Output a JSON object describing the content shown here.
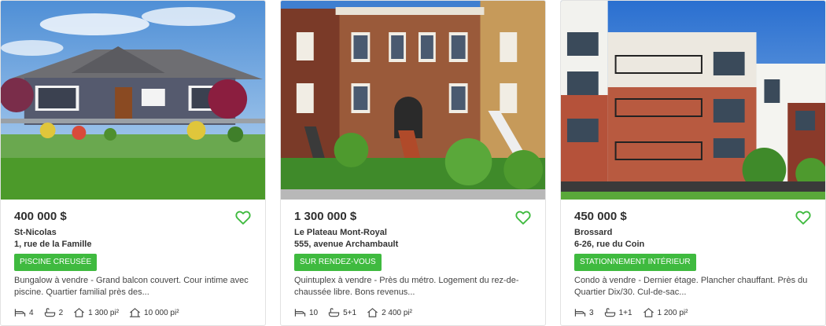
{
  "colors": {
    "accent": "#3fba3f",
    "price_text": "#2f2f2f",
    "card_border": "#e2e2e2"
  },
  "icons": {
    "favorite": "heart-outline-icon",
    "bedrooms": "bed-icon",
    "bathrooms": "bathtub-icon",
    "living_area": "house-icon",
    "lot_size": "lot-icon"
  },
  "listings": [
    {
      "price": "400 000 $",
      "city": "St-Nicolas",
      "street": "1, rue de la Famille",
      "badge": "PISCINE CREUSÉE",
      "description": "Bungalow à vendre - Grand balcon couvert. Cour intime avec piscine. Quartier familial près des...",
      "bedrooms": "4",
      "bathrooms": "2",
      "living_area": "1 300 pi²",
      "lot_size": "10 000 pi²"
    },
    {
      "price": "1 300 000 $",
      "city": "Le Plateau Mont-Royal",
      "street": "555, avenue Archambault",
      "badge": "SUR RENDEZ-VOUS",
      "description": "Quintuplex à vendre - Près du métro. Logement du rez-de-chaussée libre. Bons revenus...",
      "bedrooms": "10",
      "bathrooms": "5+1",
      "living_area": "2 400 pi²"
    },
    {
      "price": "450 000 $",
      "city": "Brossard",
      "street": "6-26, rue du Coin",
      "badge": "STATIONNEMENT INTÉRIEUR",
      "description": "Condo à vendre - Dernier étage. Plancher chauffant. Près du Quartier Dix/30. Cul-de-sac...",
      "bedrooms": "3",
      "bathrooms": "1+1",
      "living_area": "1 200 pi²"
    }
  ]
}
